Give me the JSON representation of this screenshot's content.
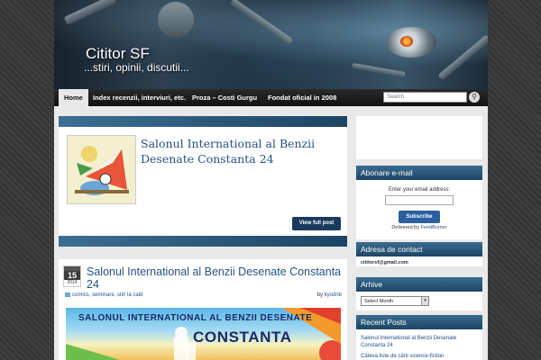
{
  "site": {
    "title": "Cititor SF",
    "description": "...stiri, opinii, discutii..."
  },
  "nav": {
    "items": [
      {
        "label": "Home",
        "active": true
      },
      {
        "label": "Index recenzii, interviuri, etc."
      },
      {
        "label": "Proza – Costi Gurgu"
      },
      {
        "label": "Fondat oficial in 2008"
      }
    ],
    "search_placeholder": "Search"
  },
  "slider": {
    "title": "Salonul International al Benzii Desenate Constanta 24",
    "button_label": "View full post",
    "dot_count": 8,
    "active_dot": 0
  },
  "post": {
    "day": "15",
    "year": "2014",
    "title": "Salonul International al Benzii Desenate Constanta 24",
    "categories": "comics, seminare, stiri la cald",
    "author_prefix": "by",
    "author": "kyodnb",
    "image_text_line1": "SALONUL  INTERNATIONAL AL BENZII DESENATE",
    "image_text_line2": "CONSTANTA"
  },
  "sidebar": {
    "email": {
      "title": "Abonare e-mail",
      "label": "Enter your email address:",
      "button": "Subscribe",
      "delivered_prefix": "Delivered by",
      "delivered_by": "FeedBurner"
    },
    "contact": {
      "title": "Adresa de contact",
      "email": "cititorsf@gmail.com"
    },
    "archives": {
      "title": "Arhive",
      "selected": "Select Month"
    },
    "recent": {
      "title": "Recent Posts",
      "items": [
        "Salonul International al Benzii Desenate Constanta 24",
        "Câteva liste de cărți science-fiction"
      ]
    }
  },
  "colors": {
    "accent": "#23538a",
    "widget_header": "#1d4563",
    "nav_bg": "#1a1a1a"
  }
}
